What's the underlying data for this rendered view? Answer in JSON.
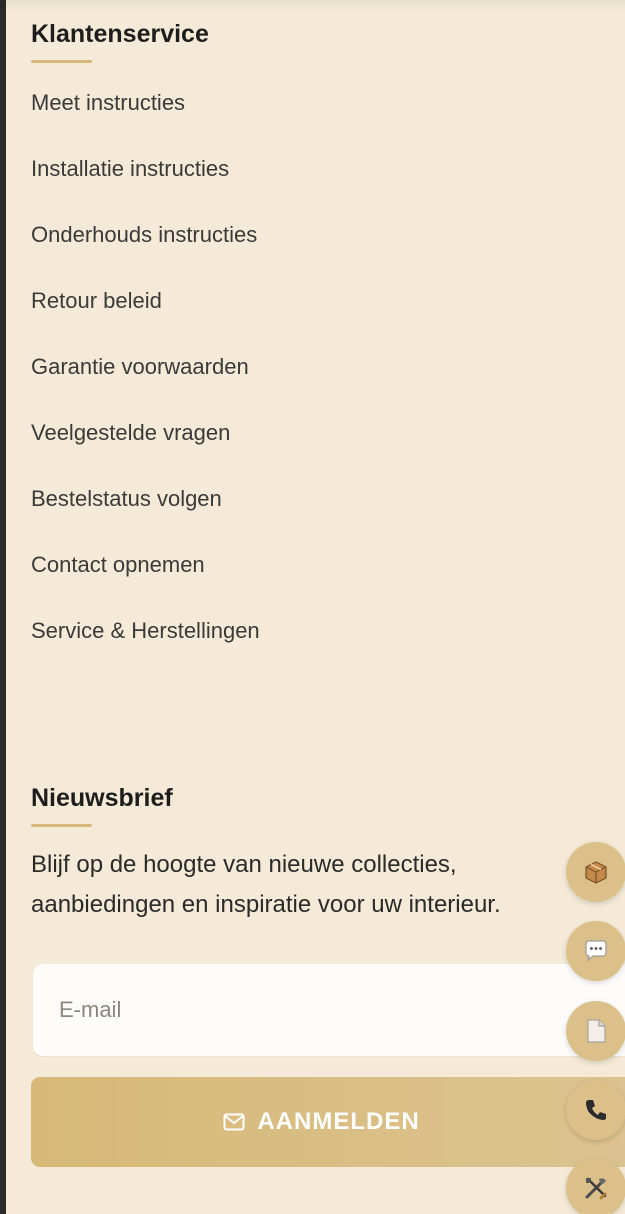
{
  "customer_service": {
    "title": "Klantenservice",
    "links": [
      "Meet instructies",
      "Installatie instructies",
      "Onderhouds instructies",
      "Retour beleid",
      "Garantie voorwaarden",
      "Veelgestelde vragen",
      "Bestelstatus volgen",
      "Contact opnemen",
      "Service & Herstellingen"
    ]
  },
  "newsletter": {
    "title": "Nieuwsbrief",
    "description": "Blijf op de hoogte van nieuwe collecties, aanbiedingen en inspiratie voor uw interieur.",
    "email_placeholder": "E-mail",
    "email_value": "",
    "button_label": "AANMELDEN"
  },
  "floating_actions": [
    {
      "icon": "package-icon"
    },
    {
      "icon": "chat-icon"
    },
    {
      "icon": "document-icon"
    },
    {
      "icon": "phone-icon"
    },
    {
      "icon": "tools-icon"
    }
  ],
  "colors": {
    "background": "#f4ead7",
    "accent": "#d7b77b",
    "button": "#d6b978",
    "text": "#1d1d1d"
  }
}
